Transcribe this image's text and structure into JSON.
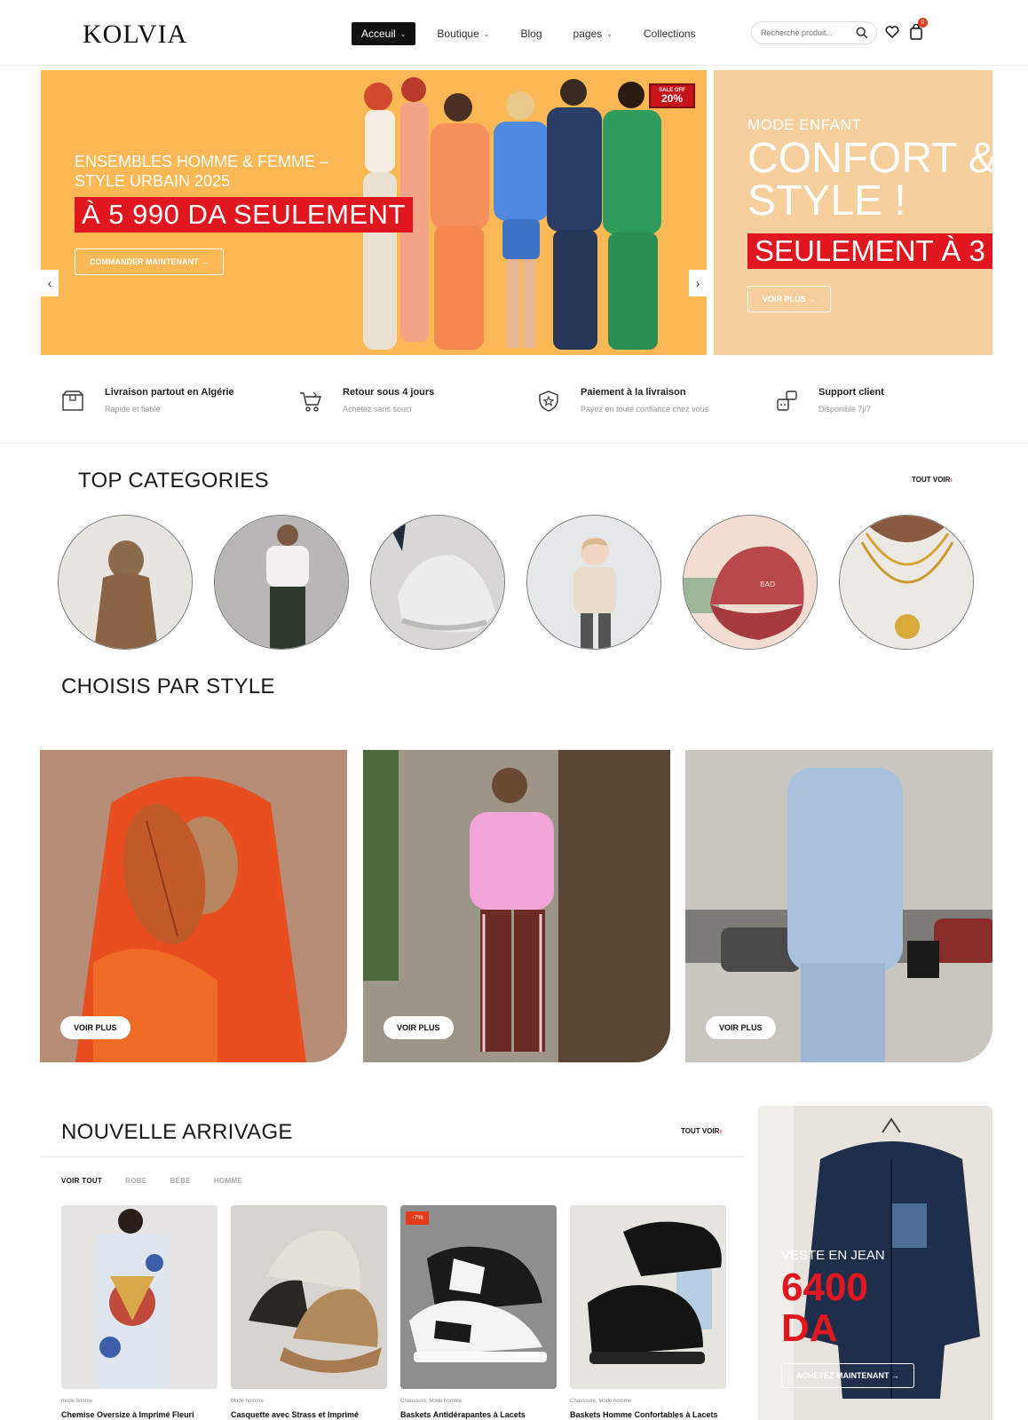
{
  "header": {
    "logo": "KOLVIA",
    "nav": [
      {
        "label": "Acceuil",
        "has_dropdown": true,
        "active": true
      },
      {
        "label": "Boutique",
        "has_dropdown": true,
        "active": false
      },
      {
        "label": "Blog",
        "has_dropdown": false,
        "active": false
      },
      {
        "label": "pages",
        "has_dropdown": true,
        "active": false
      },
      {
        "label": "Collections",
        "has_dropdown": false,
        "active": false
      }
    ],
    "search_placeholder": "Recherche produit...",
    "cart_count": "0"
  },
  "hero": {
    "main": {
      "subtitle": "ENSEMBLES HOMME & FEMME – STYLE URBAIN 2025",
      "price_banner": "À 5 990 DA SEULEMENT",
      "button": "COMMANDER MAINTENANT",
      "sale_label": "SALE OFF",
      "sale_value": "20%",
      "prev_icon": "chevron-left-icon",
      "next_icon": "chevron-right-icon"
    },
    "side": {
      "kicker": "MODE ENFANT",
      "title_line1": "CONFORT &",
      "title_line2": "STYLE !",
      "price_banner": "SEULEMENT À 3",
      "button": "VOIR PLUS"
    }
  },
  "features": [
    {
      "title": "Livraison partout en Algérie",
      "subtitle": "Rapide et fiable",
      "icon": "box-icon"
    },
    {
      "title": "Retour sous 4 jours",
      "subtitle": "Achetez sans souci",
      "icon": "cart-return-icon"
    },
    {
      "title": "Paiement à la livraison",
      "subtitle": "Payez en toute confiance chez vous",
      "icon": "shield-star-icon"
    },
    {
      "title": "Support client",
      "subtitle": "Disponible 7j/7",
      "icon": "support-icon"
    }
  ],
  "top_categories": {
    "title": "TOP CATEGORIES",
    "see_all": "TOUT VOIR"
  },
  "style_section": {
    "title": "CHOISIS PAR STYLE",
    "cards": [
      {
        "button": "VOIR PLUS"
      },
      {
        "button": "VOIR PLUS"
      },
      {
        "button": "VOIR PLUS"
      }
    ]
  },
  "new_arrivals": {
    "title": "NOUVELLE ARRIVAGE",
    "see_all": "TOUT VOIR",
    "tabs": [
      "VOIR TOUT",
      "ROBE",
      "BÉBÉ",
      "HOMME"
    ],
    "products": [
      {
        "category": "mode femme",
        "name": "Chemise Oversize à Imprimé Fleuri",
        "badge": ""
      },
      {
        "category": "Mode homme",
        "name": "Casquette avec Strass et Imprimé",
        "badge": ""
      },
      {
        "category": "Chaussure, Mode homme",
        "name": "Baskets Antidérapantes à Lacets",
        "badge": "-7%"
      },
      {
        "category": "Chaussure, Mode homme",
        "name": "Baskets Homme Confortables à Lacets",
        "badge": ""
      }
    ]
  },
  "promo": {
    "kicker": "VESTE EN JEAN",
    "price": "6400 DA",
    "button": "ACHETEZ MAINTENANT"
  }
}
